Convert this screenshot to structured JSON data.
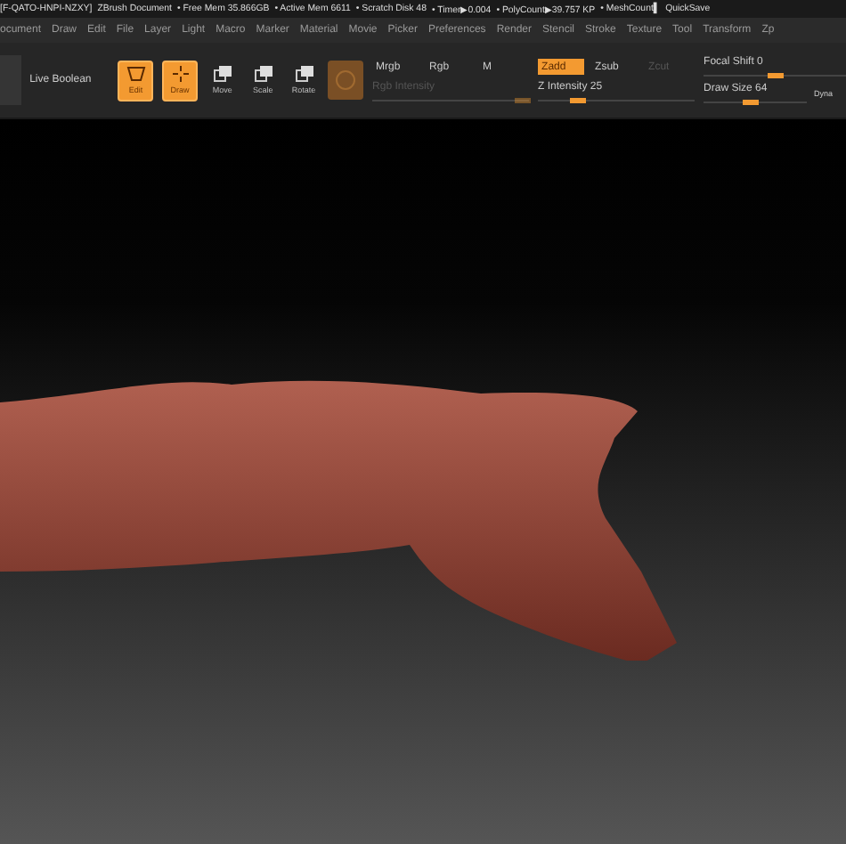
{
  "title_bar": {
    "document_id": "[F-QATO-HNPI-NZXY]",
    "document": "ZBrush Document",
    "stats": [
      "• Free Mem 35.866GB",
      "• Active Mem 6611",
      "• Scratch Disk 48",
      "• Timer▶0.004",
      "• PolyCount▶39.757 KP",
      "• MeshCount▌"
    ],
    "quicksave": "QuickSave"
  },
  "menu": [
    "ocument",
    "Draw",
    "Edit",
    "File",
    "Layer",
    "Light",
    "Macro",
    "Marker",
    "Material",
    "Movie",
    "Picker",
    "Preferences",
    "Render",
    "Stencil",
    "Stroke",
    "Texture",
    "Tool",
    "Transform",
    "Zp"
  ],
  "toolbar": {
    "live_boolean": "Live Boolean",
    "modes": [
      {
        "label": "Edit",
        "selected": true,
        "kind": "edit"
      },
      {
        "label": "Draw",
        "selected": true,
        "kind": "draw"
      },
      {
        "label": "Move",
        "selected": false,
        "kind": "move"
      },
      {
        "label": "Scale",
        "selected": false,
        "kind": "scale"
      },
      {
        "label": "Rotate",
        "selected": false,
        "kind": "rotate"
      }
    ],
    "rgb_buttons": [
      {
        "label": "Mrgb",
        "selected": false
      },
      {
        "label": "Rgb",
        "selected": false
      },
      {
        "label": "M",
        "selected": false
      }
    ],
    "rgb_intensity": {
      "label": "Rgb Intensity",
      "disabled": true,
      "level": 0.95
    },
    "z_buttons": [
      {
        "label": "Zadd",
        "selected": true,
        "disabled": false
      },
      {
        "label": "Zsub",
        "selected": false,
        "disabled": false
      },
      {
        "label": "Zcut",
        "selected": false,
        "disabled": true
      }
    ],
    "z_intensity": {
      "label": "Z Intensity 25",
      "level": 0.25
    },
    "focal_shift": {
      "label": "Focal Shift 0",
      "level": 0.5
    },
    "draw_size": {
      "label": "Draw Size 64",
      "level": 0.45
    },
    "dynamic": "Dyna"
  }
}
